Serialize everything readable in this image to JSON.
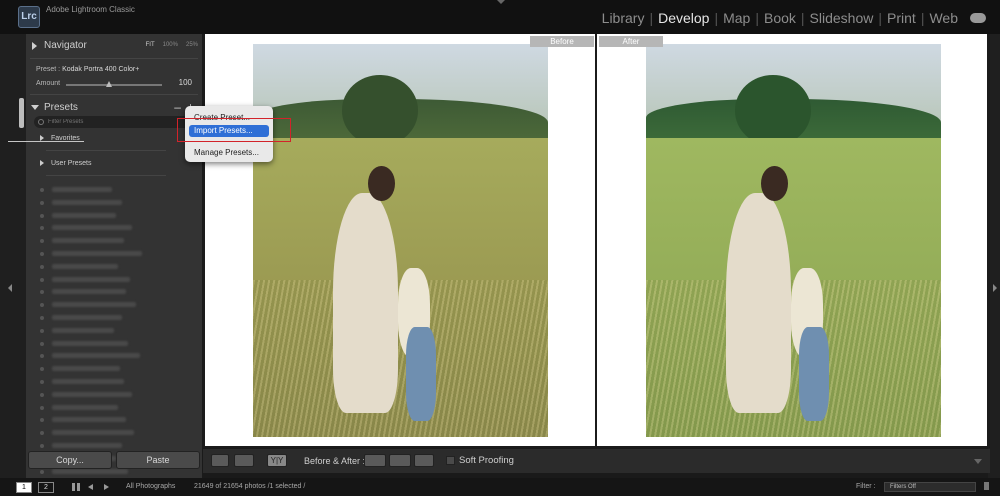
{
  "app": {
    "logo_text": "Lrc",
    "name": "Adobe Lightroom Classic",
    "modules": [
      "Library",
      "Develop",
      "Map",
      "Book",
      "Slideshow",
      "Print",
      "Web"
    ],
    "active_module": "Develop"
  },
  "left_panel": {
    "navigator": {
      "title": "Navigator",
      "zoom_options": [
        "FIT",
        "100%",
        "25%"
      ]
    },
    "preset_label": "Preset :",
    "preset_name": "Kodak Portra 400 Color+",
    "amount_label": "Amount",
    "amount_value": "100",
    "amount_fraction": 0.45,
    "presets": {
      "title": "Presets",
      "minus": "–",
      "plus": "+",
      "filter_placeholder": "Filter Presets",
      "groups": [
        "Favorites",
        "User Presets"
      ]
    },
    "copy_label": "Copy...",
    "paste_label": "Paste"
  },
  "dropdown_menu": {
    "items": [
      "Create Preset...",
      "Import Presets...",
      "Manage Presets..."
    ],
    "highlighted": "Import Presets..."
  },
  "view": {
    "before_label": "Before",
    "after_label": "After"
  },
  "toolbar": {
    "before_after_label": "Before & After :",
    "yy_label": "Y|Y",
    "soft_proofing_label": "Soft Proofing"
  },
  "bottom_bar": {
    "screen_1": "1",
    "screen_2": "2",
    "source": "All Photographs",
    "count_text": "21649 of 21654 photos /1 selected /",
    "filter_label": "Filter :",
    "filter_value": "Filters Off"
  },
  "colors": {
    "highlight": "#2f6fd6",
    "annotation_box": "#d2232a"
  }
}
